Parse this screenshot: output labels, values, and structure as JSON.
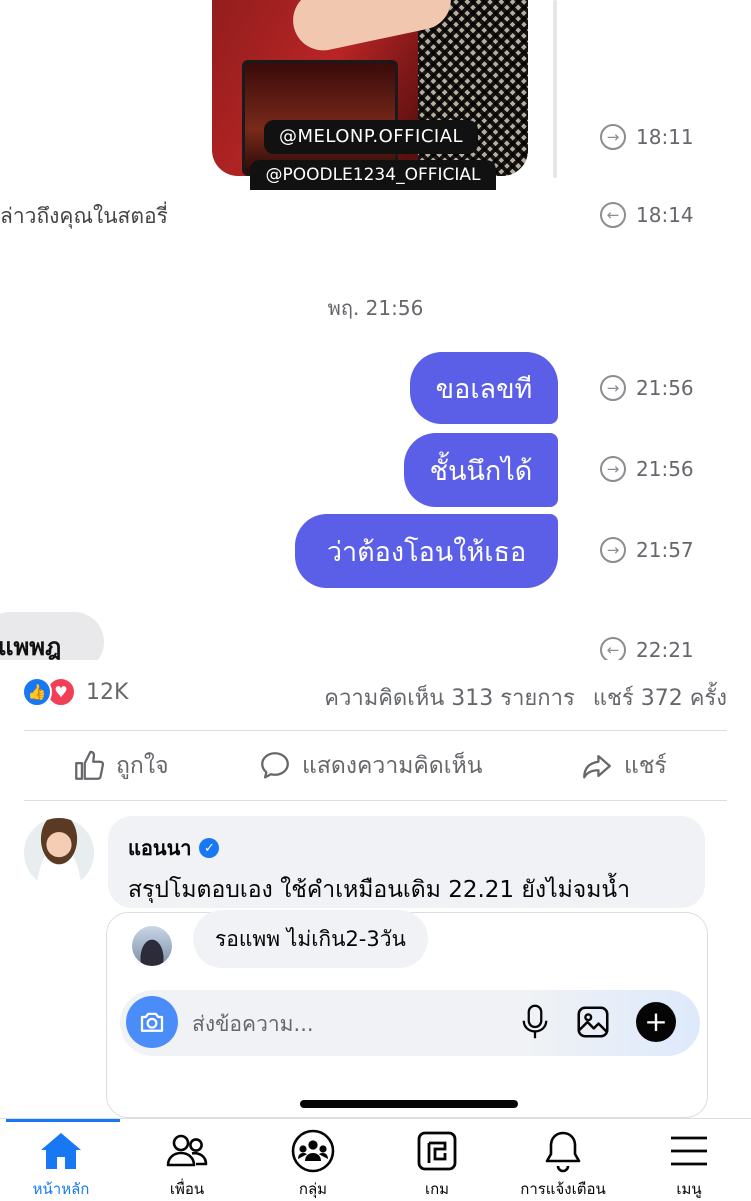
{
  "chat": {
    "story_tag_1": "@MELONP.OFFICIAL",
    "story_tag_2": "@POODLE1234_OFFICIAL",
    "story_time": "18:11",
    "mention_text": "ล่าวถึงคุณในสตอรี่",
    "mention_time": "18:14",
    "date_divider": "พฤ. 21:56",
    "messages": [
      {
        "text": "ขอเลขที",
        "time": "21:56"
      },
      {
        "text": "ชั้นนึกได้",
        "time": "21:56"
      },
      {
        "text": "ว่าต้องโอนให้เธอ",
        "time": "21:57"
      }
    ],
    "incoming_text": "แพพฎ",
    "incoming_time": "22:21",
    "colors": {
      "bubble": "#5b5ee6"
    }
  },
  "post": {
    "reaction_count": "12K",
    "comments": "ความคิดเห็น 313 รายการ",
    "shares": "แชร์ 372 ครั้ง",
    "actions": {
      "like": "ถูกใจ",
      "comment": "แสดงความคิดเห็น",
      "share": "แชร์"
    },
    "top_comment": {
      "name": "แอนนา",
      "text": "สรุปโมตอบเอง ใช้คำเหมือนเดิม 22.21 ยังไม่จมน้ำ"
    },
    "reply": {
      "text": "รอแพพ ไม่เกิน2-3วัน"
    },
    "input": {
      "placeholder": "ส่งข้อความ..."
    }
  },
  "nav": {
    "items": [
      {
        "label": "หน้าหลัก",
        "icon": "home-icon",
        "active": true
      },
      {
        "label": "เพื่อน",
        "icon": "friends-icon"
      },
      {
        "label": "กลุ่ม",
        "icon": "groups-icon"
      },
      {
        "label": "เกม",
        "icon": "gaming-icon"
      },
      {
        "label": "การแจ้งเตือน",
        "icon": "bell-icon"
      },
      {
        "label": "เมนู",
        "icon": "menu-icon"
      }
    ],
    "accent": "#1877f2"
  }
}
